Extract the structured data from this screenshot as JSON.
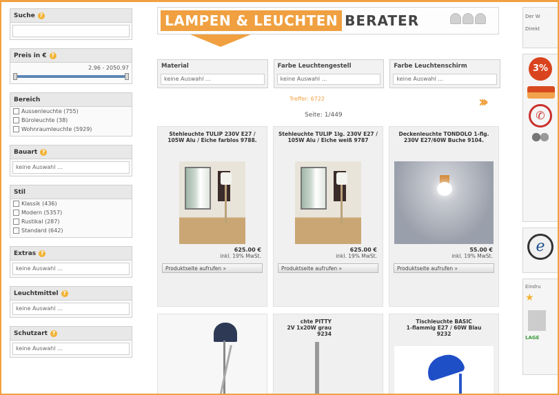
{
  "sidebar": {
    "search": {
      "title": "Suche",
      "value": ""
    },
    "price": {
      "title": "Preis in €",
      "range": "2.96 - 2050.97",
      "min": 2.96,
      "max": 2050.97
    },
    "bereich": {
      "title": "Bereich",
      "options": [
        "Aussenleuchte (755)",
        "Büroleuchte (38)",
        "Wohnraumleuchte (5929)"
      ]
    },
    "bauart": {
      "title": "Bauart",
      "value": "keine Auswahl ..."
    },
    "stil": {
      "title": "Stil",
      "options": [
        "Klassik (436)",
        "Modern (5357)",
        "Rustikal (287)",
        "Standard (642)"
      ]
    },
    "extras": {
      "title": "Extras",
      "value": "keine Auswahl ..."
    },
    "leuchtmittel": {
      "title": "Leuchtmittel",
      "value": "keine Auswahl ..."
    },
    "schutzart": {
      "title": "Schutzart",
      "value": "keine Auswahl ..."
    }
  },
  "banner": {
    "logo": "LAMPEN & LEUCHTEN",
    "subtitle": "BERATER"
  },
  "filters": [
    {
      "title": "Material",
      "value": "keine Auswahl ..."
    },
    {
      "title": "Farbe Leuchtengestell",
      "value": "keine Auswahl ..."
    },
    {
      "title": "Farbe Leuchtenschirm",
      "value": "keine Auswahl ..."
    }
  ],
  "results": {
    "hits": "Treffer: 6722",
    "page": "Seite: 1/449"
  },
  "products": [
    {
      "title": "Stehleuchte TULIP 230V E27 / 105W Alu / Eiche farblos 9788.",
      "price": "625.00 €",
      "vat": "inkl. 19% MwSt.",
      "button": "Produktseite aufrufen »"
    },
    {
      "title": "Stehleuchte TULIP 1lg. 230V E27 / 105W Alu / Eiche weiß 9787",
      "price": "625.00 €",
      "vat": "inkl. 19% MwSt.",
      "button": "Produktseite aufrufen »"
    },
    {
      "title": "Deckenleuchte TONDOLO 1-flg. 230V E27/60W Buche 9104.",
      "price": "55.00 €",
      "vat": "inkl. 19% MwSt.",
      "button": "Produktseite aufrufen »"
    }
  ],
  "products_row2": [
    {
      "title": ""
    },
    {
      "title": "chte PITTY\n2V 1x20W grau\n9234"
    },
    {
      "title": "Tischleuchte BASIC\n1-flammig E27 / 60W Blau\n9232"
    }
  ],
  "right": {
    "box1_line1": "Der W",
    "box1_line2": "Direkt",
    "badge": "3%",
    "box3_label": "Eindru",
    "box3_green": "LAGE"
  },
  "colors": {
    "accent": "#f0a040",
    "slider": "#5b86b5"
  }
}
